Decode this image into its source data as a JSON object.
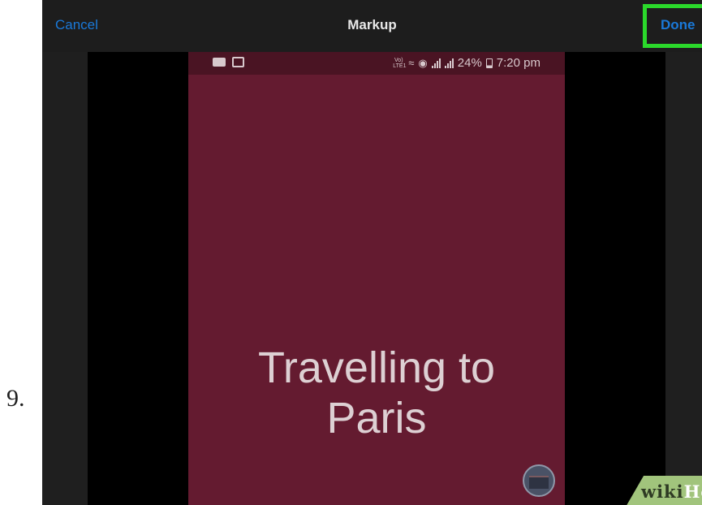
{
  "step": {
    "number": "9."
  },
  "nav": {
    "cancel_label": "Cancel",
    "title": "Markup",
    "done_label": "Done"
  },
  "phone": {
    "status_bar": {
      "left_icons": [
        "message-icon",
        "gallery-icon"
      ],
      "right_icons": [
        "volte-icon",
        "wifi-icon",
        "data-icon",
        "signal-icon",
        "signal-icon",
        "battery-icon"
      ],
      "volte_label": "Vo) LTE1",
      "battery": "24%",
      "time": "7:20 pm"
    },
    "headline_line1": "Travelling to",
    "headline_line2": "Paris"
  },
  "watermark": {
    "part1": "wiki",
    "part2": "How"
  },
  "colors": {
    "accent": "#1a79d9",
    "highlight": "#2bd92b",
    "phone_bg": "#641b30",
    "status_bg": "#4a1423",
    "watermark_bg": "#a1c47c"
  }
}
